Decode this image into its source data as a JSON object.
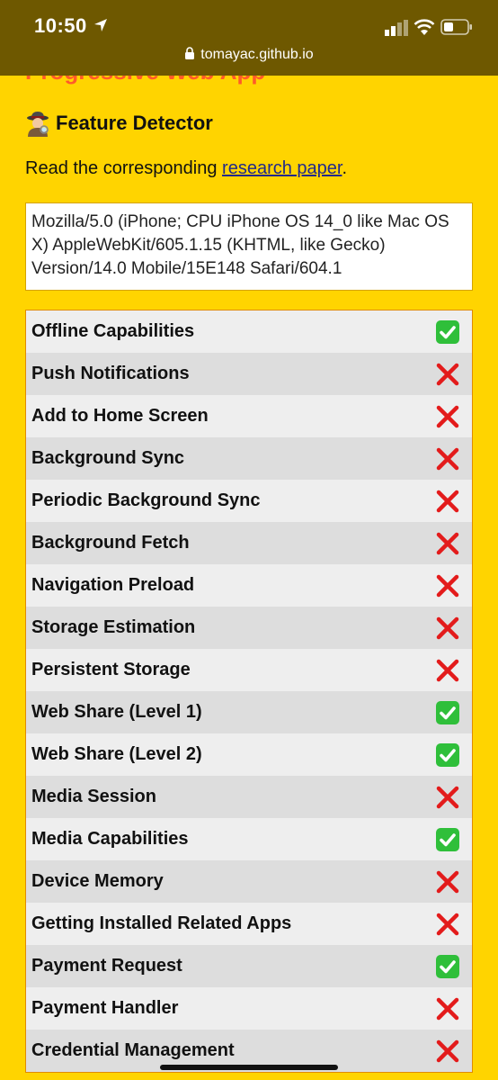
{
  "status_bar": {
    "time": "10:50",
    "url": "tomayac.github.io"
  },
  "page": {
    "title": "Progressive Web App",
    "heading": "Feature Detector",
    "intro_prefix": "Read the corresponding ",
    "intro_link": "research paper",
    "intro_suffix": ".",
    "user_agent": "Mozilla/5.0 (iPhone; CPU iPhone OS 14_0 like Mac OS X) AppleWebKit/605.1.15 (KHTML, like Gecko) Version/14.0 Mobile/15E148 Safari/604.1"
  },
  "colors": {
    "background": "#ffd400",
    "supported": "#2fbf3a",
    "unsupported": "#e31b1b"
  },
  "features": [
    {
      "name": "Offline Capabilities",
      "supported": true
    },
    {
      "name": "Push Notifications",
      "supported": false
    },
    {
      "name": "Add to Home Screen",
      "supported": false
    },
    {
      "name": "Background Sync",
      "supported": false
    },
    {
      "name": "Periodic Background Sync",
      "supported": false
    },
    {
      "name": "Background Fetch",
      "supported": false
    },
    {
      "name": "Navigation Preload",
      "supported": false
    },
    {
      "name": "Storage Estimation",
      "supported": false
    },
    {
      "name": "Persistent Storage",
      "supported": false
    },
    {
      "name": "Web Share (Level 1)",
      "supported": true
    },
    {
      "name": "Web Share (Level 2)",
      "supported": true
    },
    {
      "name": "Media Session",
      "supported": false
    },
    {
      "name": "Media Capabilities",
      "supported": true
    },
    {
      "name": "Device Memory",
      "supported": false
    },
    {
      "name": "Getting Installed Related Apps",
      "supported": false
    },
    {
      "name": "Payment Request",
      "supported": true
    },
    {
      "name": "Payment Handler",
      "supported": false
    },
    {
      "name": "Credential Management",
      "supported": false
    }
  ]
}
